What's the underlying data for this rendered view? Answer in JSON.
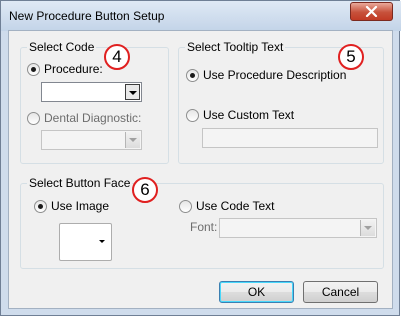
{
  "window": {
    "title": "New Procedure Button Setup"
  },
  "select_code": {
    "legend": "Select Code",
    "procedure_label": "Procedure:",
    "procedure_value": "",
    "dental_label": "Dental Diagnostic:",
    "dental_value": "",
    "badge": "4"
  },
  "tooltip": {
    "legend": "Select Tooltip Text",
    "use_description_label": "Use Procedure Description",
    "use_custom_label": "Use Custom Text",
    "custom_text_value": "",
    "badge": "5"
  },
  "button_face": {
    "legend": "Select Button Face",
    "use_image_label": "Use Image",
    "use_code_text_label": "Use Code Text",
    "font_label": "Font:",
    "font_value": "",
    "badge": "6"
  },
  "actions": {
    "ok_label": "OK",
    "cancel_label": "Cancel"
  },
  "annotation_color": "#e02020"
}
